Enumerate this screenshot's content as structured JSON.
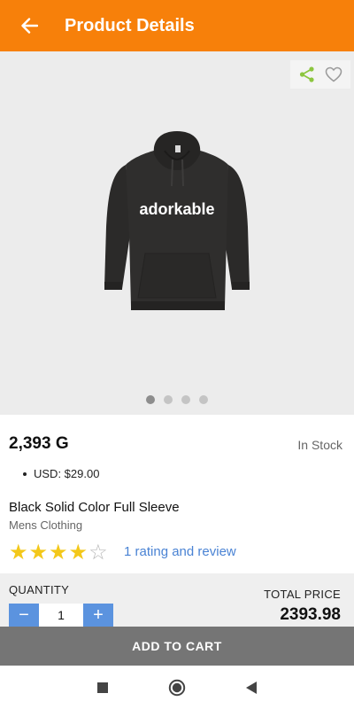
{
  "header": {
    "title": "Product Details",
    "back_icon": "arrow-left-icon",
    "color": "#f7800a"
  },
  "gallery": {
    "actions": [
      "share-icon",
      "heart-outline-icon"
    ],
    "image_text": "adorkable",
    "image_count": 4,
    "active_index": 0
  },
  "product": {
    "price": "2,393 G",
    "stock": "In Stock",
    "usd": "USD: $29.00",
    "name": "Black Solid Color Full Sleeve",
    "category": "Mens Clothing",
    "rating": 4,
    "rating_max": 5,
    "rating_link": "1 rating and review"
  },
  "purchase": {
    "quantity_label": "QUANTITY",
    "quantity": "1",
    "minus_label": "−",
    "plus_label": "+",
    "total_label": "TOTAL PRICE",
    "total": "2393.98",
    "add_to_cart": "ADD TO CART"
  },
  "navbar": {
    "items": [
      "recent-apps-icon",
      "home-icon",
      "back-triangle-icon"
    ]
  }
}
